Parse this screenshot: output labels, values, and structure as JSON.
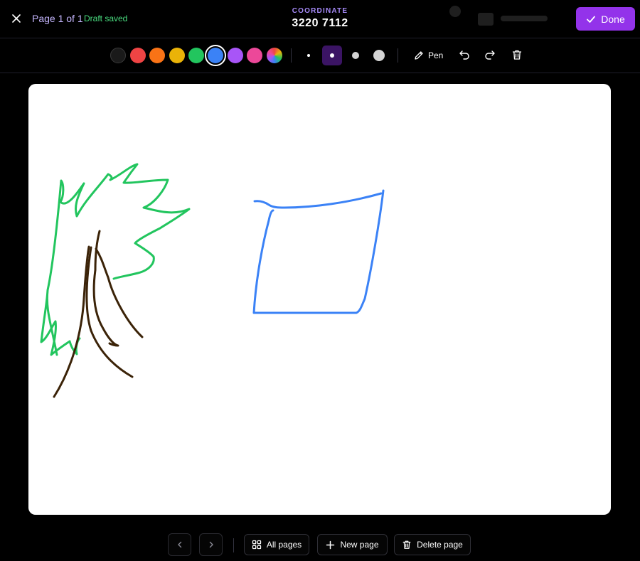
{
  "header": {
    "page_label": "Page 1 of 1",
    "draft_status": "Draft saved",
    "coordinate_label": "COORDINATE",
    "coordinate_value": "3220 7112",
    "done_label": "Done"
  },
  "toolbar": {
    "colors": [
      {
        "name": "black",
        "hex": "#1a1a1a"
      },
      {
        "name": "red",
        "hex": "#ef4444"
      },
      {
        "name": "orange",
        "hex": "#f97316"
      },
      {
        "name": "yellow",
        "hex": "#eab308"
      },
      {
        "name": "green",
        "hex": "#22c55e"
      },
      {
        "name": "blue",
        "hex": "#3b82f6"
      },
      {
        "name": "purple",
        "hex": "#a855f7"
      },
      {
        "name": "pink",
        "hex": "#ec4899"
      },
      {
        "name": "rainbow-picker",
        "hex": "conic-gradient"
      }
    ],
    "selected_color": "blue",
    "brush_sizes": [
      "xs",
      "s",
      "m",
      "l"
    ],
    "selected_size": "s",
    "tool_label": "Pen",
    "icons": [
      "pen-icon",
      "undo-icon",
      "redo-icon",
      "trash-icon"
    ]
  },
  "canvas": {
    "background": "#ffffff",
    "stroke_colors": {
      "leaves": "#22c55e",
      "trunk": "#3b2308",
      "square": "#3b82f6"
    }
  },
  "footer": {
    "all_pages_label": "All pages",
    "new_page_label": "New page",
    "delete_page_label": "Delete page"
  },
  "colors": {
    "accent": "#9333ea",
    "page_label": "#c4b5fd",
    "draft_status": "#4ade80",
    "coordinate_label": "#a78bfa"
  }
}
